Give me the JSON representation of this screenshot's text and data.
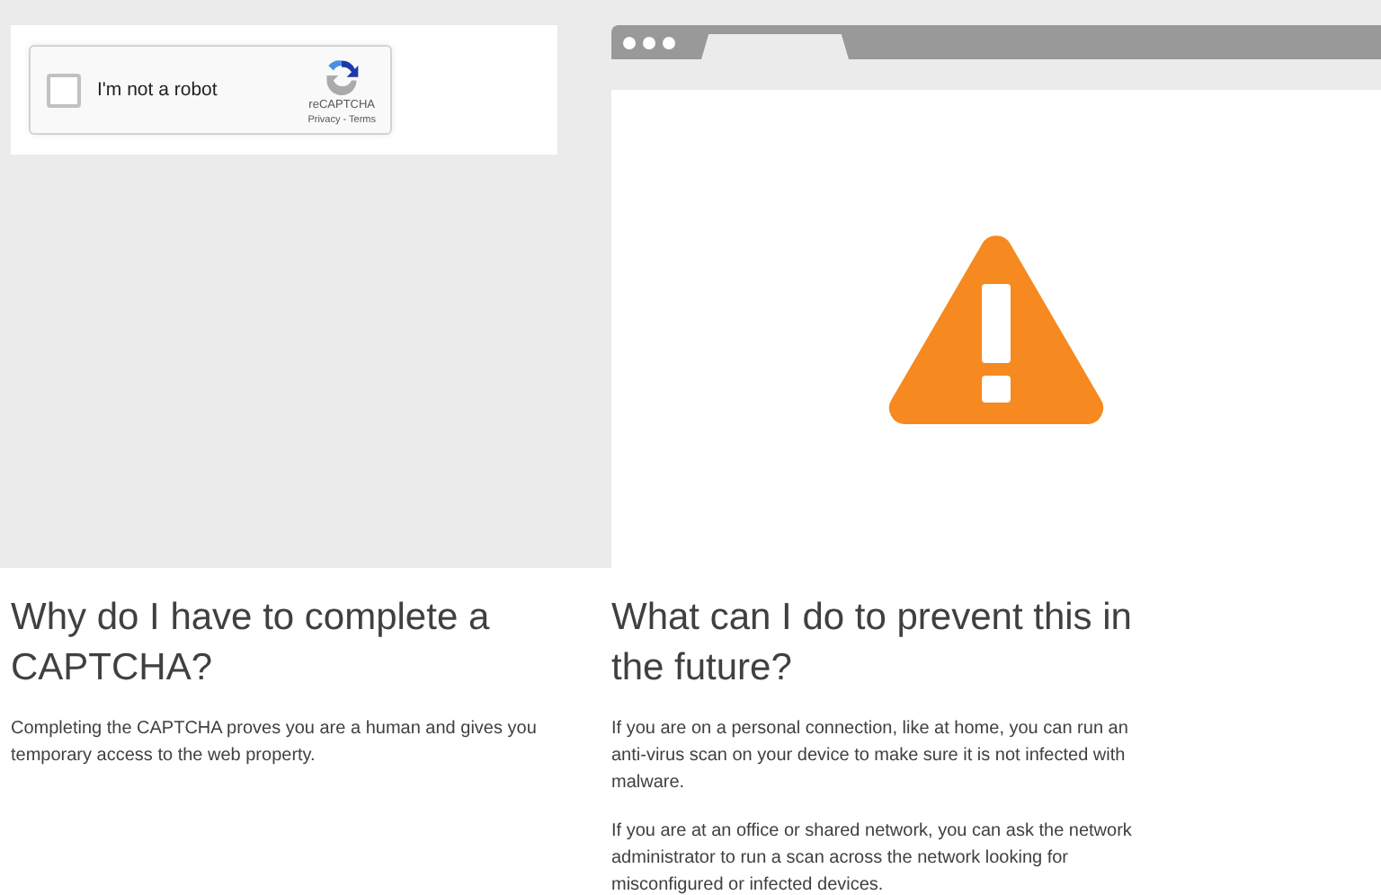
{
  "captcha": {
    "label": "I'm not a robot",
    "checked": false,
    "brand": "reCAPTCHA",
    "links": "Privacy - Terms"
  },
  "sections": [
    {
      "heading": "Why do I have to complete a CAPTCHA?",
      "paragraphs": [
        "Completing the CAPTCHA proves you are a human and gives you temporary access to the web property."
      ]
    },
    {
      "heading": "What can I do to prevent this in the future?",
      "paragraphs": [
        "If you are on a personal connection, like at home, you can run an anti-virus scan on your device to make sure it is not infected with malware.",
        "If you are at an office or shared network, you can ask the network administrator to run a scan across the network looking for misconfigured or infected devices."
      ]
    }
  ]
}
